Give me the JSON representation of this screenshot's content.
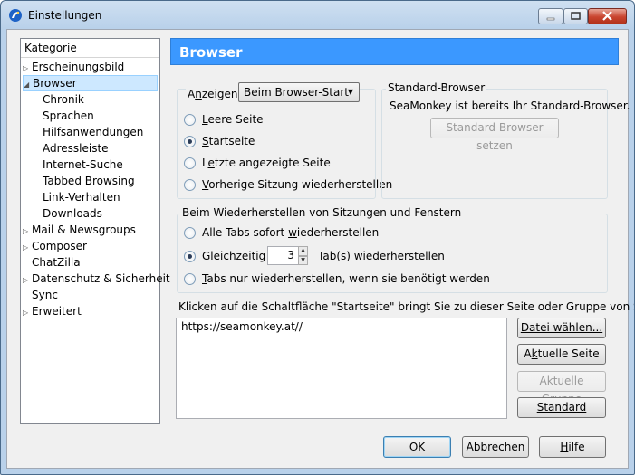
{
  "window": {
    "title": "Einstellungen",
    "app_icon": "seamonkey-icon"
  },
  "sidebar": {
    "header": "Kategorie",
    "items": [
      {
        "label": "Erscheinungsbild",
        "expander": "▷"
      },
      {
        "label": "Browser",
        "expander": "◢"
      },
      {
        "label": "Chronik"
      },
      {
        "label": "Sprachen"
      },
      {
        "label": "Hilfsanwendungen"
      },
      {
        "label": "Adressleiste"
      },
      {
        "label": "Internet-Suche"
      },
      {
        "label": "Tabbed Browsing"
      },
      {
        "label": "Link-Verhalten"
      },
      {
        "label": "Downloads"
      },
      {
        "label": "Mail & Newsgroups",
        "expander": "▷"
      },
      {
        "label": "Composer",
        "expander": "▷"
      },
      {
        "label": "ChatZilla"
      },
      {
        "label": "Datenschutz & Sicherheit",
        "expander": "▷"
      },
      {
        "label": "Sync"
      },
      {
        "label": "Erweitert",
        "expander": "▷"
      }
    ]
  },
  "panel": {
    "title": "Browser",
    "show": {
      "label_pre": "A",
      "label_u": "n",
      "label_post": "zeigen",
      "selected": "Beim Browser-Start",
      "options": [
        {
          "pre": "",
          "u": "L",
          "post": "eere Seite"
        },
        {
          "pre": "",
          "u": "S",
          "post": "tartseite"
        },
        {
          "pre": "L",
          "u": "e",
          "post": "tzte angezeigte Seite"
        },
        {
          "pre": "",
          "u": "V",
          "post": "orherige Sitzung wiederherstellen"
        }
      ]
    },
    "default_browser": {
      "legend": "Standard-Browser",
      "status": "SeaMonkey ist bereits Ihr Standard-Browser.",
      "button": "Standard-Browser setzen"
    },
    "restore": {
      "legend": "Beim Wiederherstellen von Sitzungen und Fenstern",
      "opt1_pre": "Alle Tabs sofort ",
      "opt1_u": "w",
      "opt1_post": "iederherstellen",
      "opt2_pre": "Gleich",
      "opt2_u": "z",
      "opt2_post": "eitig",
      "tabs_count": "3",
      "tabs_suffix": "Tab(s) wiederherstellen",
      "opt3_pre": "",
      "opt3_u": "T",
      "opt3_post": "abs nur wiederherstellen, wenn sie benötigt werden"
    },
    "homepage": {
      "hint": "Klicken auf die Schaltfläche \"Startseite\" bringt Sie zu dieser Seite oder Gruppe von Seiten.",
      "url": "https://seamonkey.at//",
      "btn_file": "Datei wählen...",
      "btn_current_pre": "A",
      "btn_current_u": "k",
      "btn_current_post": "tuelle Seite",
      "btn_group_pre": "Aktuelle ",
      "btn_group_u": "G",
      "btn_group_post": "ruppe",
      "btn_default": "Standard"
    }
  },
  "footer": {
    "ok": "OK",
    "cancel": "Abbrechen",
    "help_u": "H",
    "help_post": "ilfe"
  }
}
